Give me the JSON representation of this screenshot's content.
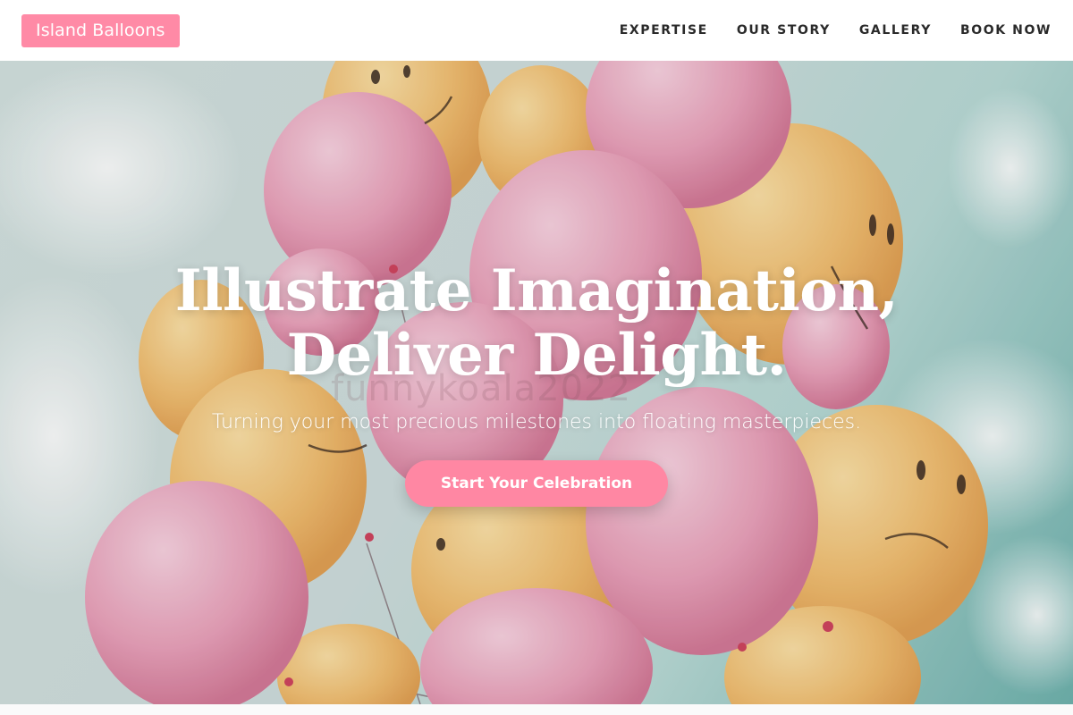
{
  "brand": {
    "logo_text": "Island Balloons",
    "accent_color": "#ff8aa6"
  },
  "nav": {
    "items": [
      {
        "label": "EXPERTISE"
      },
      {
        "label": "OUR STORY"
      },
      {
        "label": "GALLERY"
      },
      {
        "label": "BOOK NOW"
      }
    ]
  },
  "hero": {
    "headline_line1": "Illustrate Imagination,",
    "headline_line2": "Deliver Delight.",
    "subtitle": "Turning your most precious milestones into floating masterpieces.",
    "cta_label": "Start Your Celebration",
    "background": "pink and yellow smiley balloons against a cloudy blue sky"
  },
  "watermark": {
    "text": "funnykoala2022"
  }
}
